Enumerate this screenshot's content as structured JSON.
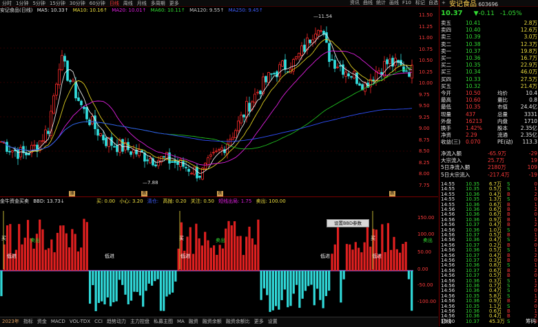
{
  "toolbar": {
    "periods": [
      "分时",
      "1分钟",
      "5分钟",
      "15分钟",
      "30分钟",
      "60分钟",
      "日线",
      "周线",
      "月线",
      "多周期",
      "更多"
    ],
    "selected": "日线",
    "right_buttons": [
      "资讯",
      "曲线",
      "统计",
      "画线",
      "F10",
      "标记",
      "自选",
      "+"
    ]
  },
  "legend": {
    "stock": "安记食品(日线)",
    "ma5": "MA5: 10.33↑",
    "ma10": "MA10: 10.16↑",
    "ma20": "MA20: 10.01↑",
    "ma60": "MA60: 10.11↑",
    "ma120": "MA120: 9.55↑",
    "ma250": "MA250: 9.45↑"
  },
  "price_axis": [
    "11.50",
    "11.25",
    "11.00",
    "10.75",
    "10.50",
    "10.25",
    "10.00",
    "9.75",
    "9.50",
    "9.25",
    "9.00",
    "8.75",
    "8.50",
    "8.25",
    "8.00",
    "7.75"
  ],
  "annotations": {
    "high": "11.54",
    "low": "7.88"
  },
  "markers": [
    "涨",
    "跌",
    "跌",
    "跌"
  ],
  "indicator": {
    "title": "金牛资金买卖",
    "bbd": "BBD: 13.73↓",
    "buy": "买: 0.00",
    "caution": "小心: 3.20",
    "light": "清仓: ",
    "high_sell": "高抛: 0.20",
    "watch": "关注: 0.50",
    "buy_sell": "短线出局: 1.75",
    "sell": "卖出: 100.00",
    "axis": [
      "150.00",
      "100.00",
      "50.00",
      "0.00",
      "-50.00",
      "-100.00"
    ],
    "labels": {
      "buy": "买",
      "sell": "卖出",
      "low": "低进"
    }
  },
  "popup_btn": "设置BBD参数",
  "bottom_tabs": [
    "指标",
    "资金",
    "MACD",
    "VOL-TDX",
    "CCI",
    "趋势动力",
    "主力控盘",
    "私募主图",
    "MA",
    "融资",
    "融资余额",
    "融资余额比",
    "更多",
    "设置"
  ],
  "bottom_year": "2023年",
  "right_panel": {
    "name": "安记食品",
    "code": "603696",
    "price": "10.37",
    "change": "-0.11",
    "pct": "-1.05%",
    "asks": [
      {
        "label": "卖五",
        "price": "10.41",
        "vol": "2.8万"
      },
      {
        "label": "卖四",
        "price": "10.40",
        "vol": "12.6万"
      },
      {
        "label": "卖三",
        "price": "10.39",
        "vol": "3.0万"
      },
      {
        "label": "卖二",
        "price": "10.38",
        "vol": "12.3万"
      },
      {
        "label": "卖一",
        "price": "10.37",
        "vol": "19.8万"
      }
    ],
    "bids": [
      {
        "label": "买一",
        "price": "10.36",
        "vol": "16.7万"
      },
      {
        "label": "买二",
        "price": "10.35",
        "vol": "22.9万"
      },
      {
        "label": "买三",
        "price": "10.34",
        "vol": "46.0万"
      },
      {
        "label": "买四",
        "price": "10.33",
        "vol": "27.5万"
      },
      {
        "label": "买五",
        "price": "10.32",
        "vol": "21.4万"
      }
    ],
    "stats": [
      {
        "k1": "今开",
        "v1": "10.50",
        "k2": "均价",
        "v2": "10.4"
      },
      {
        "k1": "最高",
        "v1": "10.60",
        "k2": "量比",
        "v2": "0.8"
      },
      {
        "k1": "最低",
        "v1": "10.35",
        "k2": "市值",
        "v2": "24.4亿"
      },
      {
        "k1": "现量",
        "v1": "437",
        "k2": "总量",
        "v2": "3331"
      },
      {
        "k1": "外盘",
        "v1": "16213",
        "k2": "内盘",
        "v2": "1710"
      },
      {
        "k1": "换手",
        "v1": "1.42%",
        "k2": "股本",
        "v2": "2.35亿"
      },
      {
        "k1": "净资",
        "v1": "2.29",
        "k2": "流通",
        "v2": "2.35亿"
      },
      {
        "k1": "收益(三)",
        "v1": "0.070",
        "k2": "PE(动)",
        "v2": "113.3"
      }
    ],
    "flows": [
      {
        "k": "净流入额",
        "v": "-65.9万",
        "v2": "-29"
      },
      {
        "k": "大宗流入",
        "v": "25.7万",
        "v2": "19"
      },
      {
        "k": "5日净流入额",
        "v": "2180万",
        "v2": "109"
      },
      {
        "k": "5日大宗流入",
        "v": "-217.4万",
        "v2": "-19"
      }
    ],
    "ticks": [
      {
        "t": "14:55",
        "p": "10.35",
        "v": "6.7万",
        "s": "S"
      },
      {
        "t": "14:55",
        "p": "10.35",
        "v": "0.5万",
        "s": "S"
      },
      {
        "t": "14:55",
        "p": "10.36",
        "v": "0.4万",
        "s": "B"
      },
      {
        "t": "14:55",
        "p": "10.35",
        "v": "1.3万",
        "s": "S"
      },
      {
        "t": "14:55",
        "p": "10.36",
        "v": "0.6万",
        "s": "B"
      },
      {
        "t": "14:56",
        "p": "10.36",
        "v": "0.6万",
        "s": "B"
      },
      {
        "t": "14:56",
        "p": "10.36",
        "v": "0.6万",
        "s": "B"
      },
      {
        "t": "14:56",
        "p": "10.36",
        "v": "0.9万",
        "s": "B"
      },
      {
        "t": "14:56",
        "p": "10.37",
        "v": "0.4万",
        "s": "B"
      },
      {
        "t": "14:56",
        "p": "10.36",
        "v": "1.0万",
        "s": "S"
      },
      {
        "t": "14:56",
        "p": "10.37",
        "v": "0.5万",
        "s": "B"
      },
      {
        "t": "14:56",
        "p": "10.36",
        "v": "0.4万",
        "s": "S"
      },
      {
        "t": "14:56",
        "p": "10.37",
        "v": "0.2万",
        "s": "B"
      },
      {
        "t": "14:56",
        "p": "10.36",
        "v": "0.5万",
        "s": "S"
      },
      {
        "t": "14:56",
        "p": "10.37",
        "v": "0.4万",
        "s": "B"
      },
      {
        "t": "14:56",
        "p": "10.37",
        "v": "0.3万",
        "s": "B"
      },
      {
        "t": "14:56",
        "p": "10.36",
        "v": "0.8万",
        "s": "S"
      },
      {
        "t": "14:56",
        "p": "10.37",
        "v": "0.6万",
        "s": "B"
      },
      {
        "t": "14:56",
        "p": "10.37",
        "v": "0.5万",
        "s": "B"
      },
      {
        "t": "14:56",
        "p": "10.36",
        "v": "0.3万",
        "s": "S"
      },
      {
        "t": "14:56",
        "p": "10.36",
        "v": "0.7万",
        "s": "S"
      },
      {
        "t": "14:56",
        "p": "10.36",
        "v": "0.4万",
        "s": "S"
      },
      {
        "t": "14:56",
        "p": "10.35",
        "v": "5.8万",
        "s": "S"
      },
      {
        "t": "14:56",
        "p": "10.36",
        "v": "0.9万",
        "s": "B"
      },
      {
        "t": "14:56",
        "p": "10.35",
        "v": "1.1万",
        "s": "S"
      },
      {
        "t": "14:56",
        "p": "10.36",
        "v": "0.6万",
        "s": "B"
      },
      {
        "t": "14:56",
        "p": "10.36",
        "v": "0.4万",
        "s": "B"
      },
      {
        "t": "15:00",
        "p": "10.37",
        "v": "45.3万",
        "s": "S"
      }
    ],
    "bottom_label": "日线",
    "bottom_btn": "筹码"
  },
  "colors": {
    "up": "#ff2a2a",
    "down": "#33e0e0",
    "bg": "#000000",
    "ma5": "#e8e8e8",
    "ma10": "#e0d020",
    "ma20": "#e020e0",
    "ma60": "#20c020",
    "ma120": "#3050ff",
    "ma250": "#a0a0a0"
  }
}
